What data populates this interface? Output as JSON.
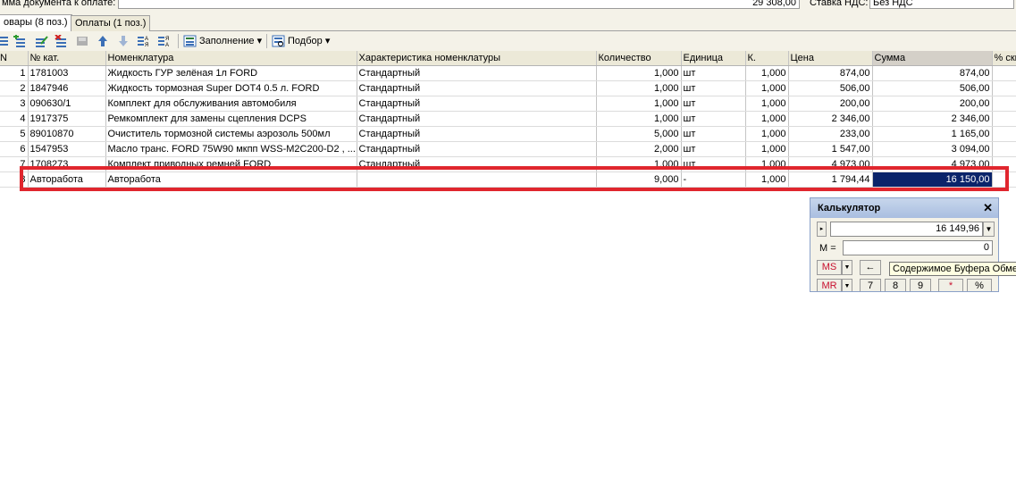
{
  "header": {
    "sum_label": "мма документа к оплате:",
    "sum_value": "29 308,00",
    "vat_label": "Ставка НДС:",
    "vat_value": "Без НДС"
  },
  "tabs": [
    {
      "label": "овары (8 поз.)",
      "active": true
    },
    {
      "label": "Оплаты (1 поз.)",
      "active": false
    }
  ],
  "toolbar": {
    "fill_label": "Заполнение",
    "pick_label": "Подбор",
    "icons": [
      "add-row-icon",
      "add-copy-icon",
      "edit-row-icon",
      "delete-row-icon",
      "end-edit-icon",
      "move-up-icon",
      "move-down-icon",
      "sort-asc-icon",
      "sort-desc-icon",
      "fill-icon",
      "pick-icon"
    ]
  },
  "table": {
    "columns": [
      "N",
      "№ кат.",
      "Номенклатура",
      "Характеристика номенклатуры",
      "Количество",
      "Единица",
      "К.",
      "Цена",
      "Сумма",
      "% ски"
    ],
    "rows": [
      [
        "1",
        "1781003",
        "Жидкость ГУР зелёная 1л FORD",
        "Стандартный",
        "1,000",
        "шт",
        "1,000",
        "874,00",
        "874,00",
        ""
      ],
      [
        "2",
        "1847946",
        "Жидкость тормозная Super DOT4 0.5 л. FORD",
        "Стандартный",
        "1,000",
        "шт",
        "1,000",
        "506,00",
        "506,00",
        ""
      ],
      [
        "3",
        "090630/1",
        "Комплект для обслуживания автомобиля",
        "Стандартный",
        "1,000",
        "шт",
        "1,000",
        "200,00",
        "200,00",
        ""
      ],
      [
        "4",
        "1917375",
        "Ремкомплект для замены сцепления DCPS",
        "Стандартный",
        "1,000",
        "шт",
        "1,000",
        "2 346,00",
        "2 346,00",
        ""
      ],
      [
        "5",
        "89010870",
        "Очиститель тормозной системы аэрозоль 500мл",
        "Стандартный",
        "5,000",
        "шт",
        "1,000",
        "233,00",
        "1 165,00",
        ""
      ],
      [
        "6",
        "1547953",
        "Масло транс. FORD 75W90 мкпп WSS-M2C200-D2 , ...",
        "Стандартный",
        "2,000",
        "шт",
        "1,000",
        "1 547,00",
        "3 094,00",
        ""
      ],
      [
        "7",
        "1708273",
        "Комплект приводных ремней FORD",
        "Стандартный",
        "1,000",
        "шт",
        "1,000",
        "4 973,00",
        "4 973,00",
        ""
      ],
      [
        "8",
        "Авторабота",
        "Авторабота",
        "",
        "9,000",
        "-",
        "1,000",
        "1 794,44",
        "16 150,00",
        ""
      ]
    ]
  },
  "calculator": {
    "title": "Калькулятор",
    "display": "16 149,96",
    "memory_label": "M =",
    "memory_value": "0",
    "ms_label": "MS",
    "mr_label": "MR",
    "backspace_label": "←",
    "digits": [
      "7",
      "8",
      "9"
    ],
    "mul_label": "*",
    "percent_label": "%",
    "close_label": "✕",
    "tooltip": "Содержимое Буфера Обмена"
  },
  "colors": {
    "highlight": "#e0262e",
    "selection": "#0a246a",
    "calc_title": "#b8cae6"
  }
}
